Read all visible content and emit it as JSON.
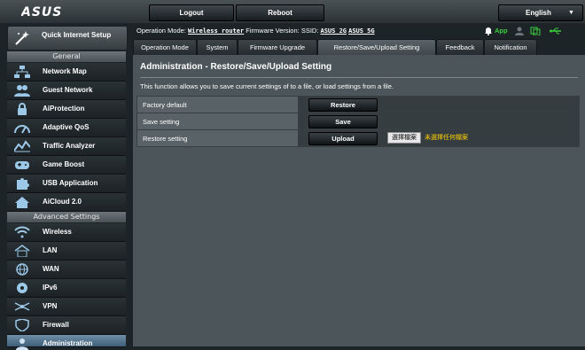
{
  "top": {
    "logo_text": "ASUS",
    "logout": "Logout",
    "reboot": "Reboot",
    "language": "English"
  },
  "status": {
    "mode_label": "Operation Mode:",
    "mode_value": "Wireless router",
    "fw_label": "Firmware Version:",
    "ssid_label": "SSID:",
    "ssid_2g": "ASUS_2G",
    "ssid_5g": "ASUS_5G",
    "app_label": "App"
  },
  "sidebar": {
    "qis_label": "Quick Internet Setup",
    "general_header": "General",
    "general_items": [
      {
        "label": "Network Map"
      },
      {
        "label": "Guest Network"
      },
      {
        "label": "AiProtection"
      },
      {
        "label": "Adaptive QoS"
      },
      {
        "label": "Traffic Analyzer"
      },
      {
        "label": "Game Boost"
      },
      {
        "label": "USB Application"
      },
      {
        "label": "AiCloud 2.0"
      }
    ],
    "advanced_header": "Advanced Settings",
    "advanced_items": [
      {
        "label": "Wireless"
      },
      {
        "label": "LAN"
      },
      {
        "label": "WAN"
      },
      {
        "label": "IPv6"
      },
      {
        "label": "VPN"
      },
      {
        "label": "Firewall"
      },
      {
        "label": "Administration"
      }
    ]
  },
  "tabs": [
    {
      "label": "Operation Mode"
    },
    {
      "label": "System"
    },
    {
      "label": "Firmware Upgrade"
    },
    {
      "label": "Restore/Save/Upload Setting"
    },
    {
      "label": "Feedback"
    },
    {
      "label": "Notification"
    }
  ],
  "main": {
    "title": "Administration - Restore/Save/Upload Setting",
    "description": "This function allows you to save current settings of to a file, or load settings from a file.",
    "rows": [
      {
        "label": "Factory default",
        "button": "Restore"
      },
      {
        "label": "Save setting",
        "button": "Save"
      },
      {
        "label": "Restore setting",
        "button": "Upload"
      }
    ],
    "file_button": "選擇檔案",
    "no_file_text": "未選擇任何檔案"
  }
}
